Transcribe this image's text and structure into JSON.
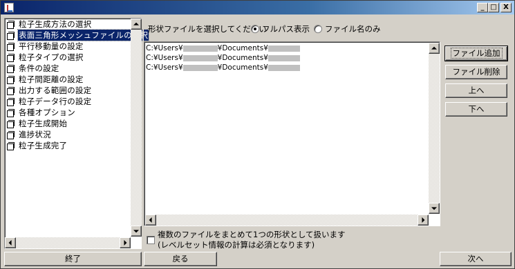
{
  "window": {
    "title": "",
    "minimize_glyph": "_",
    "maximize_glyph": "□",
    "close_glyph": "X"
  },
  "steps": [
    {
      "label": "粒子生成方法の選択",
      "selected": false
    },
    {
      "label": "表面三角形メッシュファイルの選択",
      "selected": true
    },
    {
      "label": "平行移動量の設定",
      "selected": false
    },
    {
      "label": "粒子タイプの選択",
      "selected": false
    },
    {
      "label": "条件の設定",
      "selected": false
    },
    {
      "label": "粒子間距離の設定",
      "selected": false
    },
    {
      "label": "出力する範囲の設定",
      "selected": false
    },
    {
      "label": "粒子データ行の設定",
      "selected": false
    },
    {
      "label": "各種オプション",
      "selected": false
    },
    {
      "label": "粒子生成開始",
      "selected": false
    },
    {
      "label": "進捗状況",
      "selected": false
    },
    {
      "label": "粒子生成完了",
      "selected": false
    }
  ],
  "shape_file": {
    "prompt": "形状ファイルを選択してください",
    "radio_full_path": "フルパス表示",
    "radio_file_name": "ファイル名のみ",
    "selected_display": "full_path",
    "files": [
      {
        "prefix": "C:¥Users¥",
        "middle": "¥Documents¥"
      },
      {
        "prefix": "C:¥Users¥",
        "middle": "¥Documents¥"
      },
      {
        "prefix": "C:¥Users¥",
        "middle": "¥Documents¥"
      }
    ],
    "buttons": {
      "add": "ファイル追加",
      "delete": "ファイル削除",
      "up": "上へ",
      "down": "下へ"
    },
    "merge_checkbox": {
      "checked": false,
      "label_line1": "複数のファイルをまとめて1つの形状として扱います",
      "label_line2": "(レベルセット情報の計算は必須となります)"
    }
  },
  "footer": {
    "exit": "終了",
    "back": "戻る",
    "next": "次へ"
  }
}
